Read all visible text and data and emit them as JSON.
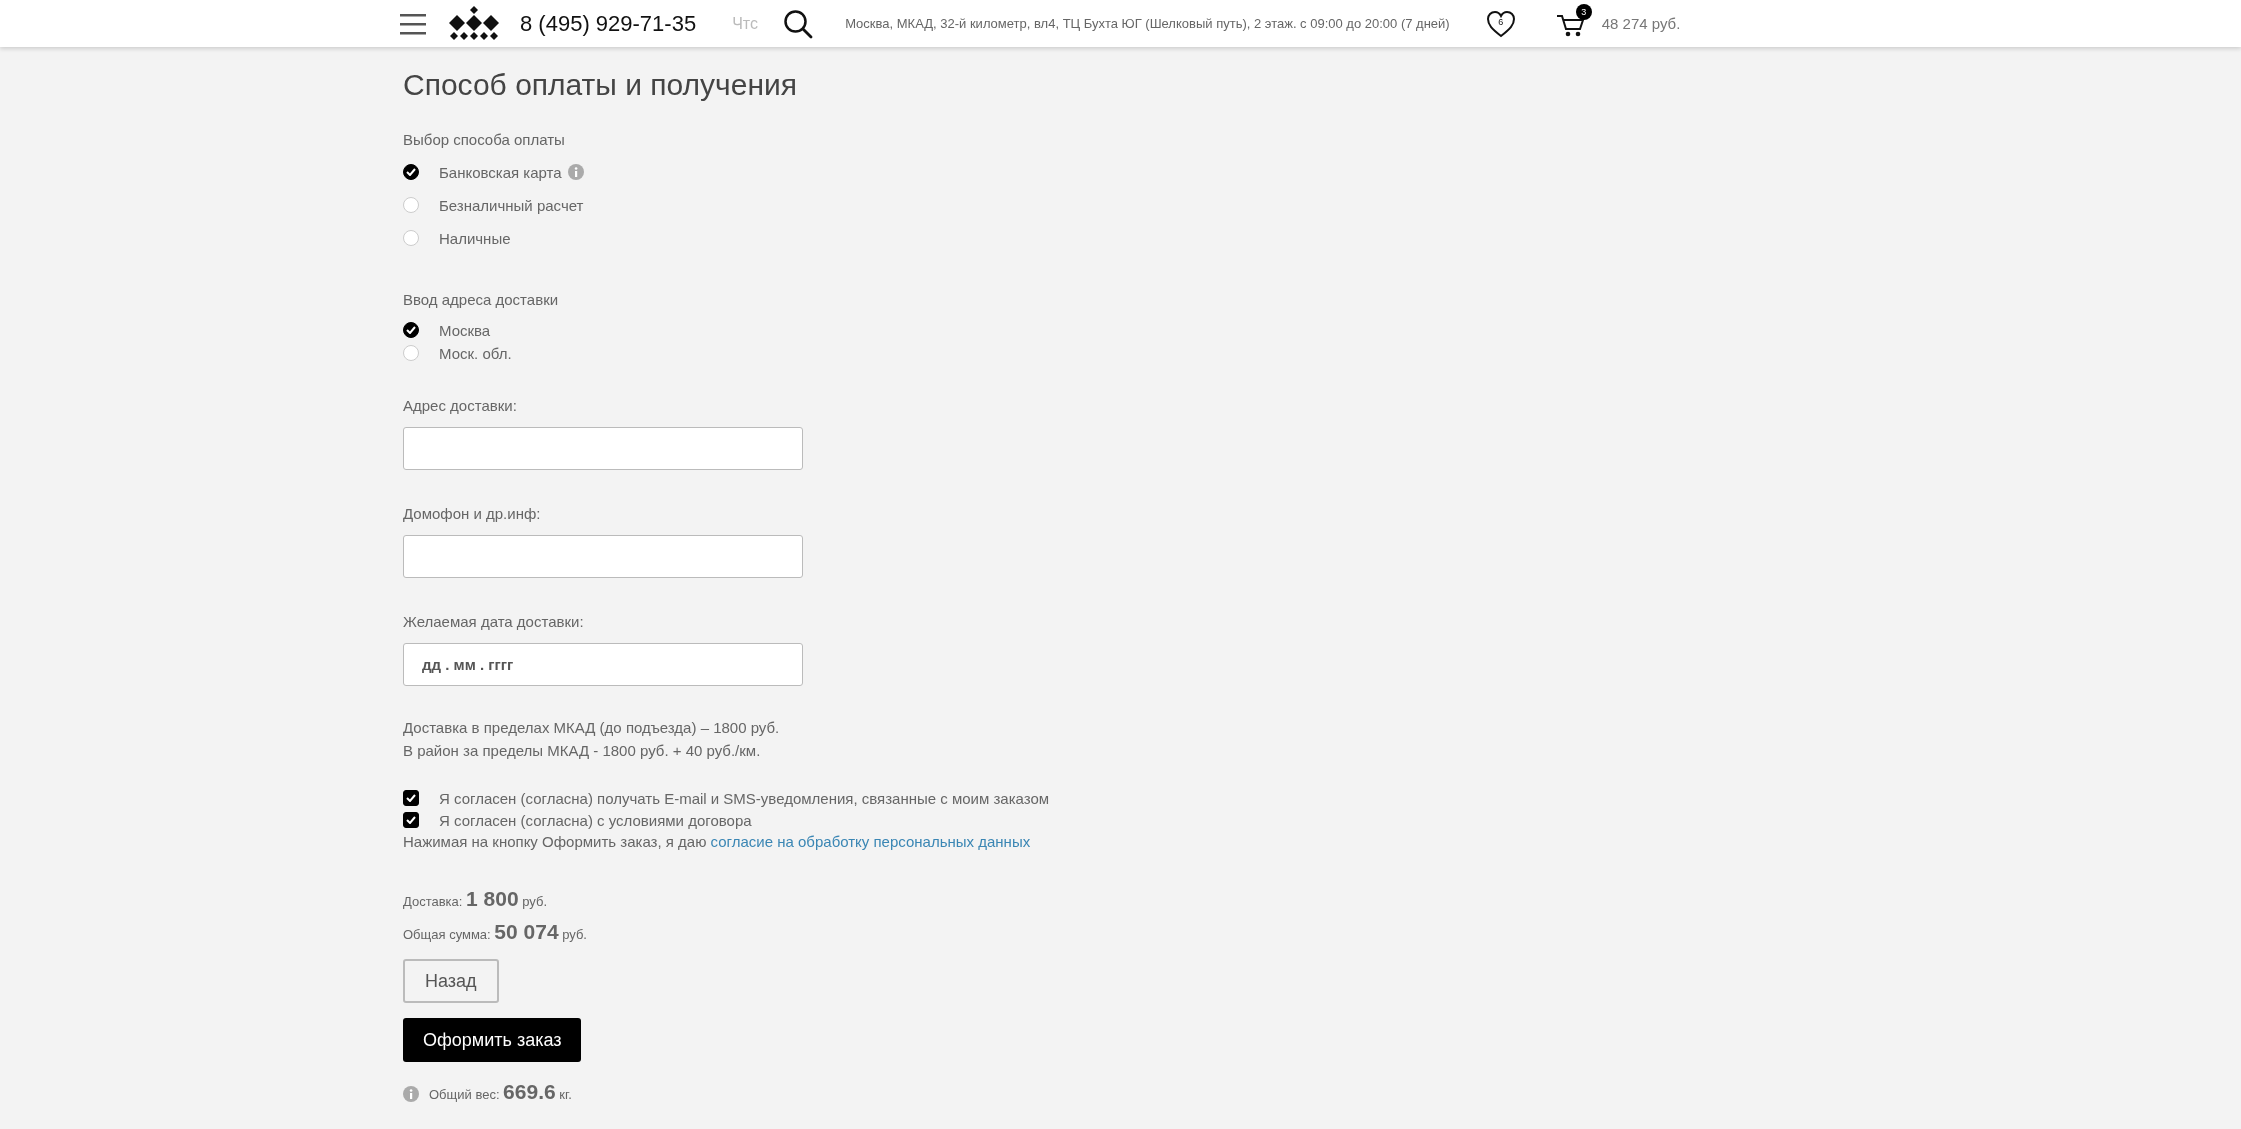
{
  "header": {
    "phone": "8 (495) 929-71-35",
    "search_placeholder": "Чтс",
    "address": "Москва, МКАД, 32-й километр, вл4, ТЦ Бухта ЮГ (Шелковый путь), 2 этаж. с 09:00 до 20:00 (7 дней)",
    "favorites_count": "6",
    "cart_count": "3",
    "cart_total": "48 274 руб."
  },
  "title": "Способ оплаты и получения",
  "payment": {
    "label": "Выбор способа оплаты",
    "options": [
      {
        "label": "Банковская карта",
        "selected": true,
        "info": true
      },
      {
        "label": "Безналичный расчет",
        "selected": false,
        "info": false
      },
      {
        "label": "Наличные",
        "selected": false,
        "info": false
      }
    ]
  },
  "delivery_region": {
    "label": "Ввод адреса доставки",
    "options": [
      {
        "label": "Москва",
        "selected": true
      },
      {
        "label": "Моск. обл.",
        "selected": false
      }
    ]
  },
  "fields": [
    {
      "label": "Адрес доставки:"
    },
    {
      "label": "Домофон и др.инф:"
    },
    {
      "label": "Желаемая дата доставки:",
      "placeholder": "дд . мм . гггг"
    }
  ],
  "delivery_notes": [
    "Доставка в пределах МКАД (до подъезда) – 1800 руб.",
    "В район за пределы МКАД - 1800 руб. + 40 руб./км."
  ],
  "agreements": [
    {
      "label": "Я согласен (согласна) получать E-mail и SMS-уведомления, связанные с моим заказом",
      "checked": true
    },
    {
      "label": "Я согласен (согласна) с условиями договора",
      "checked": true
    }
  ],
  "consent": {
    "text": "Нажимая на кнопку Оформить заказ, я даю",
    "link": "согласие на обработку персональных данных"
  },
  "totals": [
    {
      "label": "Доставка:",
      "value": "1 800",
      "unit": "руб."
    },
    {
      "label": "Общая сумма:",
      "value": "50 074",
      "unit": "руб."
    }
  ],
  "buttons": [
    {
      "label": "Назад",
      "kind": "secondary"
    },
    {
      "label": "Оформить заказ",
      "kind": "primary"
    }
  ],
  "weight": {
    "label": "Общий вес:",
    "value": "669.6",
    "unit": "кг."
  }
}
